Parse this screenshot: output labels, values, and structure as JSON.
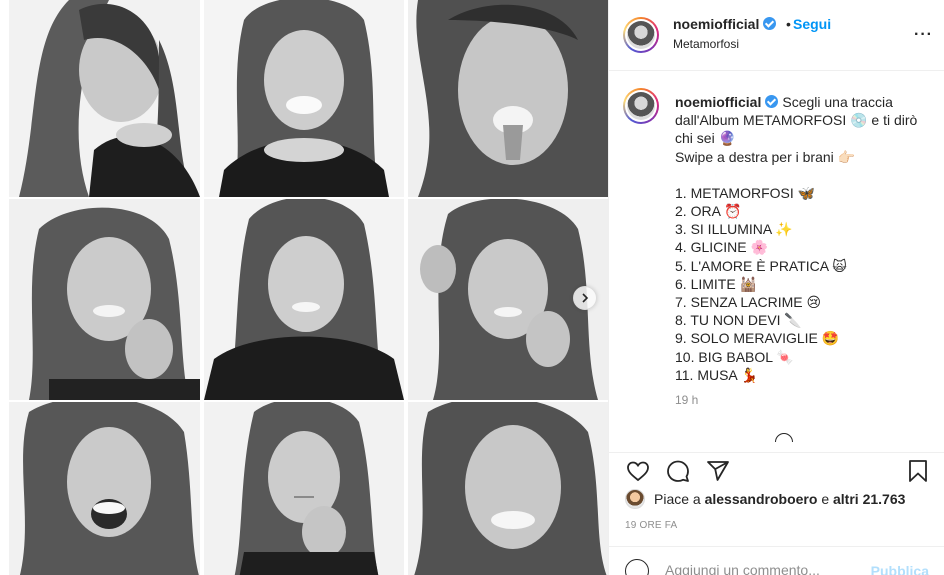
{
  "header": {
    "username": "noemiofficial",
    "separator": "•",
    "follow_label": "Segui",
    "subtitle": "Metamorfosi",
    "more_label": "···"
  },
  "caption": {
    "username": "noemiofficial",
    "line1": "Scegli una traccia dall'Album METAMORFOSI 💿 e ti dirò chi sei 🔮",
    "line2": "Swipe a destra per i brani 👉🏻",
    "tracks": [
      "1. METAMORFOSI 🦋",
      "2. ORA ⏰",
      "3. SI ILLUMINA ✨",
      "4. GLICINE 🌸",
      "5. L'AMORE È PRATICA 🙀",
      "6. LIMITE 🕍",
      "7. SENZA LACRIME 😢",
      "8. TU NON DEVI 🔪",
      "9. SOLO MERAVIGLIE 🤩",
      "10. BIG BABOL 🍬",
      "11. MUSA 💃"
    ],
    "time": "19 h"
  },
  "likes": {
    "prefix": "Piace a",
    "user": "alessandroboero",
    "middle": "e",
    "others": "altri 21.763"
  },
  "date": "19 ORE FA",
  "comment": {
    "placeholder": "Aggiungi un commento...",
    "publish_label": "Pubblica"
  },
  "icons": {
    "verified": "verified-badge-icon",
    "like": "heart-icon",
    "comment": "comment-icon",
    "share": "share-icon",
    "save": "bookmark-icon",
    "next": "chevron-right-icon",
    "emoji": "emoji-icon"
  },
  "colors": {
    "link_blue": "#0095f6",
    "publish_disabled": "#b2dffc",
    "muted": "#8e8e8e",
    "text": "#262626"
  }
}
